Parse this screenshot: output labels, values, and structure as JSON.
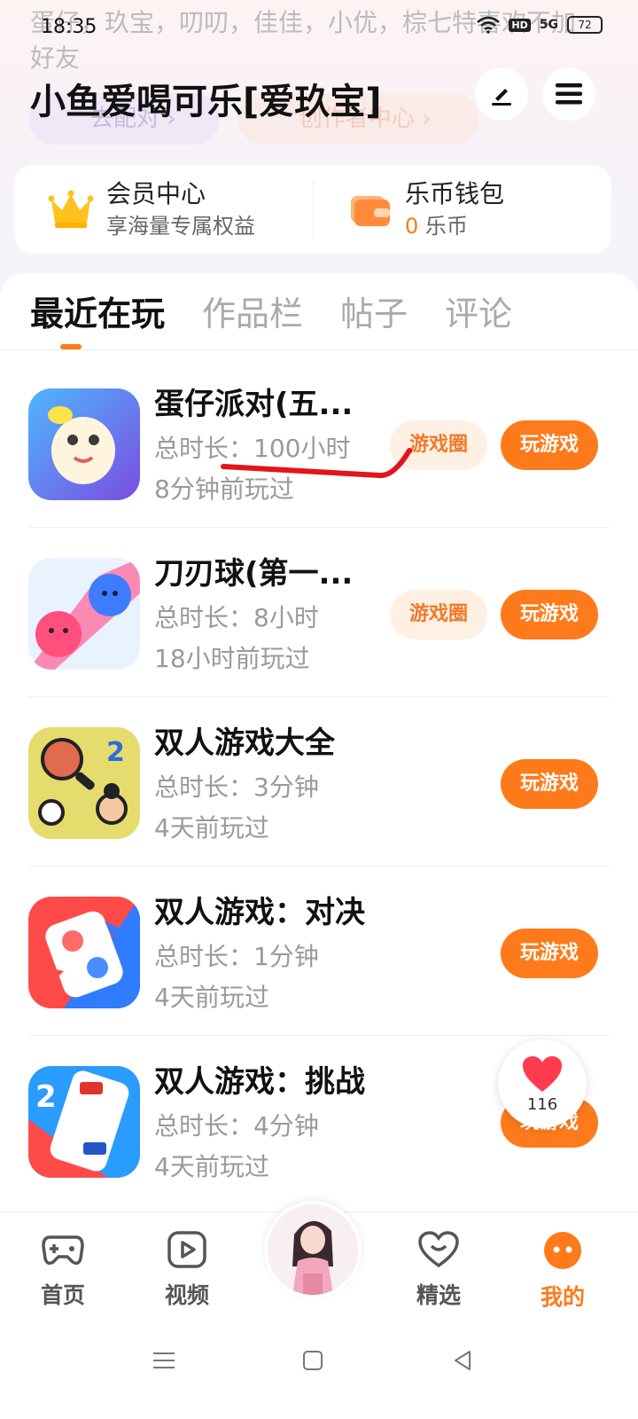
{
  "status_bar": {
    "time": "18:35",
    "battery": "72",
    "hd": "HD",
    "signal": "5G"
  },
  "profile": {
    "bio": "蛋仔，玖宝，叨叨，佳佳，小优，棕七特喜欢不加好友",
    "username": "小鱼爱喝可乐[爱玖宝]",
    "match_pill": "去配对 ›",
    "creator_pill": "创作者中心 ›"
  },
  "cards": {
    "vip": {
      "title": "会员中心",
      "subtitle": "享海量专属权益"
    },
    "wallet": {
      "title": "乐币钱包",
      "amount": "0",
      "unit": " 乐币"
    }
  },
  "tabs": [
    "最近在玩",
    "作品栏",
    "帖子",
    "评论"
  ],
  "games": [
    {
      "name": "蛋仔派对(五...",
      "duration": "总时长：100小时",
      "last_played": "8分钟前玩过",
      "circle": "游戏圈",
      "play": "玩游戏"
    },
    {
      "name": "刀刃球(第一...",
      "duration": "总时长：8小时",
      "last_played": "18小时前玩过",
      "circle": "游戏圈",
      "play": "玩游戏"
    },
    {
      "name": "双人游戏大全",
      "duration": "总时长：3分钟",
      "last_played": "4天前玩过",
      "play": "玩游戏"
    },
    {
      "name": "双人游戏：对决",
      "duration": "总时长：1分钟",
      "last_played": "4天前玩过",
      "play": "玩游戏"
    },
    {
      "name": "双人游戏：挑战",
      "duration": "总时长：4分钟",
      "last_played": "4天前玩过",
      "play": "玩游戏"
    }
  ],
  "like": {
    "count": "116"
  },
  "bottom_nav": {
    "home": "首页",
    "video": "视频",
    "picks": "精选",
    "mine": "我的"
  },
  "colors": {
    "accent": "#ff7a1a",
    "accent_light": "#fff0e4",
    "annotation": "#e3141b"
  }
}
